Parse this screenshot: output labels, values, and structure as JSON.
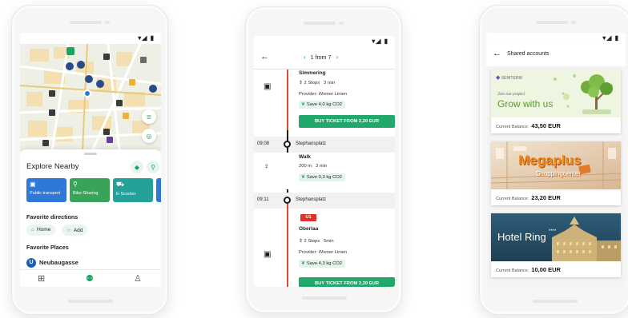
{
  "status_bar": "▾◢ ▮",
  "phone1": {
    "sheet_title": "Explore Nearby",
    "tiles": [
      {
        "label": "Public transport",
        "color": "#2f78d6"
      },
      {
        "label": "Bike-Sharing",
        "color": "#3aa35a"
      },
      {
        "label": "E-Scooter",
        "color": "#26a19a"
      }
    ],
    "favorite_directions_label": "Favorite directions",
    "chips": [
      "Home",
      "Add"
    ],
    "favorite_places_label": "Favorite Places",
    "place_badge": "U",
    "place_name": "Neubaugasse"
  },
  "phone2": {
    "pager": "1 from 7",
    "seg1": {
      "name": "Simmering",
      "stops": "2 Stops",
      "duration": "3 min",
      "provider": "Provider: Wiener Linien",
      "co2": "Save 4,0 kg CO2",
      "button": "BUY TICKET FROM 2,20 EUR"
    },
    "stop1": {
      "time": "09:08",
      "name": "Stephansplatz"
    },
    "walk": {
      "title": "Walk",
      "distance": "200 m",
      "duration": "3 min",
      "co2": "Save 0,3 kg CO2"
    },
    "stop2": {
      "time": "09:11",
      "name": "Stephansplatz"
    },
    "seg2": {
      "line": "U1",
      "name": "Oberlaa",
      "stops": "2 Stops",
      "duration": "5min",
      "provider": "Provider: Wiener Linien",
      "co2": "Save 4,3 kg CO2",
      "button": "BUY TICKET FROM 2,20 EUR"
    }
  },
  "phone3": {
    "title": "Shared accounts",
    "cards": [
      {
        "brand": "SENITERM",
        "tagline": "Join our project",
        "headline": "Grow with us",
        "balance_label": "Current Balance:",
        "balance": "43,50 EUR"
      },
      {
        "brand": "Megaplus",
        "sub": "Shoppingcenter",
        "balance_label": "Current Balance:",
        "balance": "23,20 EUR"
      },
      {
        "brand": "Hotel Ring",
        "stars": "****",
        "balance_label": "Current Balance:",
        "balance": "10,00 EUR"
      }
    ]
  }
}
